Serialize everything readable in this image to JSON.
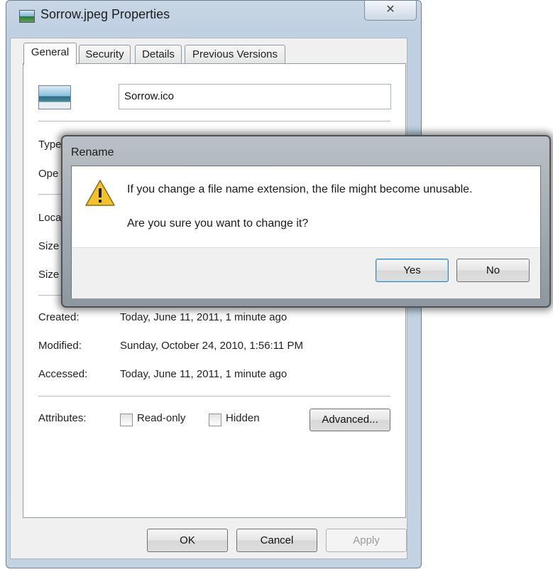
{
  "props_window": {
    "title": "Sorrow.jpeg Properties",
    "close_glyph": "✕",
    "tabs": [
      "General",
      "Security",
      "Details",
      "Previous Versions"
    ],
    "file_name_value": "Sorrow.ico",
    "labels_partial": [
      "Type",
      "Ope",
      "Loca",
      "Size",
      "Size"
    ],
    "dates": [
      {
        "label": "Created:",
        "value": "Today, June 11, 2011, 1 minute ago"
      },
      {
        "label": "Modified:",
        "value": "Sunday, October 24, 2010, 1:56:11 PM"
      },
      {
        "label": "Accessed:",
        "value": "Today, June 11, 2011, 1 minute ago"
      }
    ],
    "attributes_label": "Attributes:",
    "readonly_label": "Read-only",
    "hidden_label": "Hidden",
    "advanced_button": "Advanced...",
    "ok_button": "OK",
    "cancel_button": "Cancel",
    "apply_button": "Apply"
  },
  "rename_dialog": {
    "title": "Rename",
    "message": "If you change a file name extension, the file might become unusable.",
    "question": "Are you sure you want to change it?",
    "yes_button": "Yes",
    "no_button": "No",
    "icon": "warning-icon"
  },
  "colors": {
    "warning": "#f2c12e",
    "default_button_border": "#3c7fb1"
  }
}
